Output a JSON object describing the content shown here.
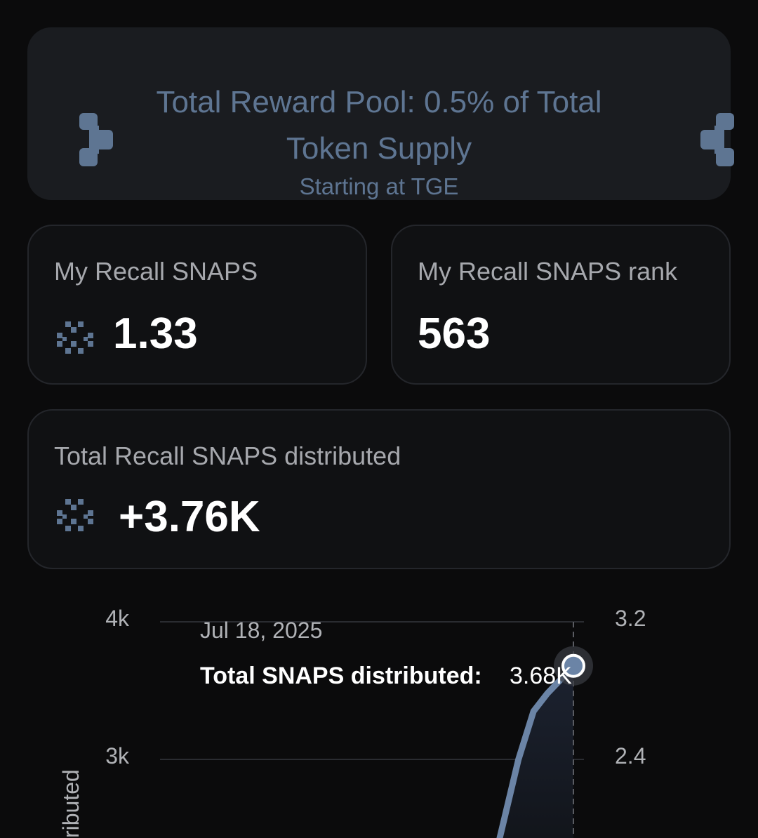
{
  "banner": {
    "title": "Total Reward Pool: 0.5% of Total Token Supply",
    "subtitle": "Starting at TGE"
  },
  "stats": {
    "my_snaps": {
      "label": "My Recall SNAPS",
      "value": "1.33",
      "icon": "snaps-token-icon"
    },
    "my_rank": {
      "label": "My Recall SNAPS rank",
      "value": "563"
    },
    "total_distributed": {
      "label": "Total Recall SNAPS distributed",
      "value": "+3.76K",
      "icon": "snaps-token-icon"
    }
  },
  "chart": {
    "tooltip_date": "Jul 18, 2025",
    "tooltip_label": "Total SNAPS distributed:",
    "tooltip_value": "3.68K",
    "left_ticks": [
      "4k",
      "3k"
    ],
    "right_ticks": [
      "3.2",
      "2.4"
    ],
    "ylabel_partial": "ributed"
  },
  "chart_data": {
    "type": "area",
    "ylim": [
      2000,
      4000
    ],
    "y_ticks_left": [
      "4k",
      "3k"
    ],
    "y_ticks_right": [
      "3.2",
      "2.4"
    ],
    "series": [
      {
        "values": [
          2420,
          3000,
          3350,
          3480,
          3580,
          3680
        ]
      }
    ],
    "highlight": {
      "x": "Jul 18, 2025",
      "y": 3680
    },
    "grid": true,
    "colors": {
      "line": "#6b84a6",
      "fill": "#171c24"
    }
  },
  "theme": {
    "background": "#0b0b0c",
    "accent": "#5e7592",
    "card_border": "#24262b"
  }
}
